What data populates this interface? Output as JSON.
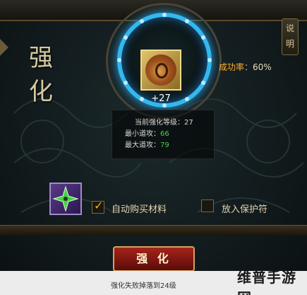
{
  "panel": {
    "title_chars": [
      "强",
      "化"
    ],
    "help_tab_chars": [
      "说",
      "明"
    ]
  },
  "item": {
    "level_display": "+27",
    "icon": "bronze-mirror-icon"
  },
  "success_rate": {
    "label": "成功率：",
    "value": "60%"
  },
  "stats": {
    "current_level_label": "当前强化等级：27",
    "min_attack_label": "最小道攻：",
    "min_attack_value": "66",
    "max_attack_label": "最大道攻：",
    "max_attack_value": "79"
  },
  "options": {
    "auto_buy_label": "自动购买材料",
    "auto_buy_checked": true,
    "protect_label": "放入保护符",
    "protect_checked": false
  },
  "skill_icon": "green-shuriken-icon",
  "strengthen_button_label": "强 化",
  "bottom_note": "强化失败掉落到24级",
  "watermark": "维普手游网",
  "colors": {
    "ring": "#33b8f0",
    "success_label": "#ffb030",
    "stat_value": "#48d048",
    "button": "#a4241a"
  }
}
